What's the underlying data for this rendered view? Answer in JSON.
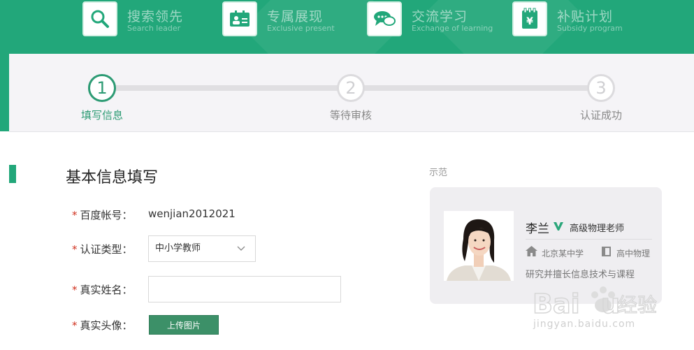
{
  "features": [
    {
      "title": "搜索领先",
      "subtitle": "Search leader",
      "icon": "search-icon"
    },
    {
      "title": "专属展现",
      "subtitle": "Exclusive present",
      "icon": "id-card-icon"
    },
    {
      "title": "交流学习",
      "subtitle": "Exchange of learning",
      "icon": "chat-icon"
    },
    {
      "title": "补贴计划",
      "subtitle": "Subsidy program",
      "icon": "yuan-clipboard-icon"
    }
  ],
  "steps": [
    {
      "number": "1",
      "label": "填写信息",
      "active": true
    },
    {
      "number": "2",
      "label": "等待审核",
      "active": false
    },
    {
      "number": "3",
      "label": "认证成功",
      "active": false
    }
  ],
  "form": {
    "title": "基本信息填写",
    "required_mark": "*",
    "account_label": "百度帐号：",
    "account_value": "wenjian2012021",
    "type_label": "认证类型：",
    "type_value": "中小学教师",
    "name_label": "真实姓名：",
    "name_value": "",
    "avatar_label": "真实头像：",
    "upload_button": "上传图片"
  },
  "example": {
    "label": "示范",
    "name": "李兰",
    "title": "高级物理老师",
    "school": "北京某中学",
    "subject": "高中物理",
    "description": "研究并擅长信息技术与课程"
  },
  "watermark": {
    "logo": "Baidu经验",
    "url": "jingyan.baidu.com"
  },
  "colors": {
    "brand_green": "#22a77a",
    "step_active": "#2d9b74",
    "required_red": "#d0311f",
    "upload_button": "#3c9068"
  }
}
